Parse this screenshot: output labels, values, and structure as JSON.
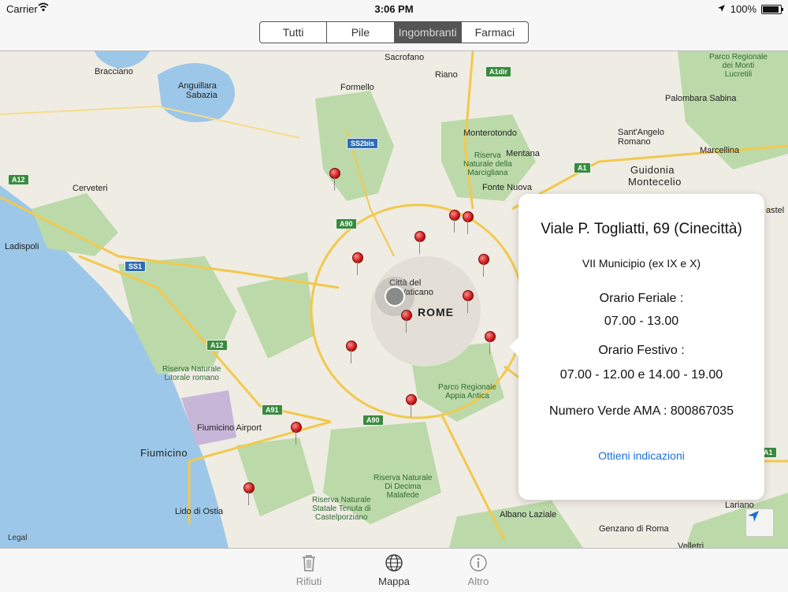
{
  "status_bar": {
    "carrier": "Carrier",
    "time": "3:06 PM",
    "battery": "100%"
  },
  "segmented": {
    "selected": "Ingombranti",
    "items": [
      {
        "label": "Tutti"
      },
      {
        "label": "Pile"
      },
      {
        "label": "Ingombranti"
      },
      {
        "label": "Farmaci"
      }
    ]
  },
  "map": {
    "legal": "Legal",
    "labels": {
      "bracciano": "Bracciano",
      "anguillara": "Anguillara",
      "sabazia": "Sabazia",
      "formello": "Formello",
      "sacrofano": "Sacrofano",
      "riano": "Riano",
      "monterotondo": "Monterotondo",
      "mentana": "Mentana",
      "fonte_nuova": "Fonte Nuova",
      "santangelo": "Sant'Angelo",
      "romano": "Romano",
      "marcellina": "Marcellina",
      "palombara": "Palombara Sabina",
      "guidonia": "Guidonia",
      "montecelio": "Montecelio",
      "castel": "astel",
      "cerveteri": "Cerveteri",
      "ladispoli": "Ladispoli",
      "citta1": "Città del",
      "citta2": "Vaticano",
      "rome": "ROME",
      "fiumicino_airport": "Fiumicino Airport",
      "fiumicino": "Fiumicino",
      "lido": "Lido di Ostia",
      "albano": "Albano Laziale",
      "lariano": "Lariano",
      "genzano": "Genzano di Roma",
      "velletri": "Velletri"
    },
    "parks": {
      "monti_lucretili": "Parco Regionale\ndei Monti\nLucretili",
      "marcigliana": "Riserva\nNaturale della\nMarcigliana",
      "litorale": "Riserva Naturale\nLitorale romano",
      "appia": "Parco Regionale\nAppia Antica",
      "decima": "Riserva Naturale\nDi Decima\nMalafede",
      "castelporziano": "Riserva Naturale\nStatale Tenuta di\nCastelporziano"
    },
    "shields": {
      "a12_north": "A12",
      "a1dir": "A1dir",
      "ss2bis": "SS2bis",
      "a1": "A1",
      "a90_west": "A90",
      "ss1": "SS1",
      "a12_south": "A12",
      "a91": "A91",
      "a90_south": "A90",
      "a1_east": "A1"
    }
  },
  "popover": {
    "title": "Viale P. Togliatti, 69 (Cinecittà)",
    "municipio": "VII Municipio (ex IX e X)",
    "feriale_label": "Orario Feriale :",
    "feriale_value": "07.00 - 13.00",
    "festivo_label": "Orario Festivo :",
    "festivo_value": "07.00 - 12.00 e 14.00 - 19.00",
    "verde": "Numero Verde AMA :  800867035",
    "directions": "Ottieni indicazioni"
  },
  "tab_bar": {
    "selected": "Mappa",
    "items": [
      {
        "label": "Rifiuti",
        "icon": "trash-icon"
      },
      {
        "label": "Mappa",
        "icon": "globe-icon"
      },
      {
        "label": "Altro",
        "icon": "info-icon"
      }
    ]
  },
  "colors": {
    "accent": "#1a6fd8",
    "pin": "#c81818",
    "park": "#bcd9a9",
    "land": "#efece4",
    "water": "#9cc7e8"
  }
}
